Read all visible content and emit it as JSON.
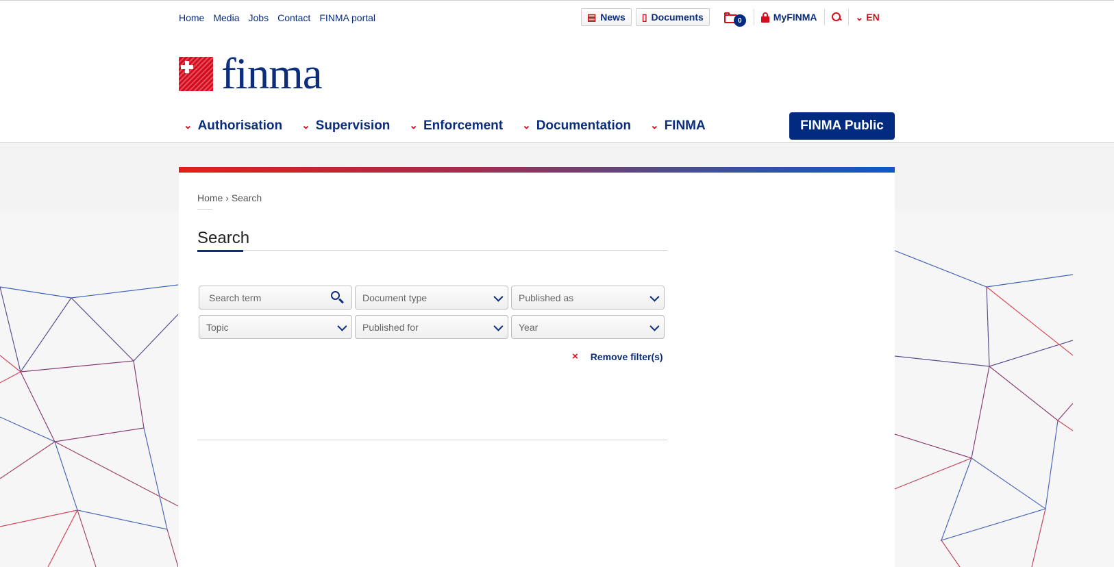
{
  "header": {
    "utility_links": [
      "Home",
      "Media",
      "Jobs",
      "Contact",
      "FINMA portal"
    ],
    "news_label": "News",
    "documents_label": "Documents",
    "cart_count": "0",
    "myfinma_label": "MyFINMA",
    "language": "EN",
    "logo_text": "finma",
    "nav_items": [
      "Authorisation",
      "Supervision",
      "Enforcement",
      "Documentation",
      "FINMA"
    ],
    "public_button": "FINMA Public"
  },
  "page": {
    "breadcrumb_home": "Home",
    "breadcrumb_sep": "›",
    "breadcrumb_current": "Search",
    "title": "Search"
  },
  "filters": {
    "search_placeholder": "Search term",
    "document_type": "Document type",
    "published_as": "Published as",
    "topic": "Topic",
    "published_for": "Published for",
    "year": "Year",
    "remove_label": "Remove filter(s)",
    "remove_x": "×"
  },
  "colors": {
    "brand_blue": "#0b2d7a",
    "brand_red": "#d50c1d"
  }
}
